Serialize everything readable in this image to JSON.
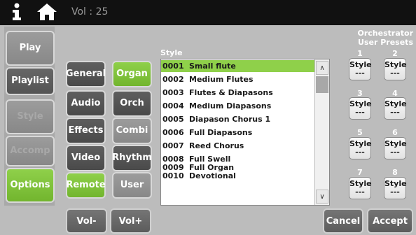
{
  "topbar": {
    "volume": "Vol : 25"
  },
  "left_nav": {
    "play": "Play",
    "playlist": "Playlist",
    "style": "Style",
    "accomp": "Accomp",
    "options": "Options"
  },
  "settings": {
    "general": "General",
    "audio": "Audio",
    "effects": "Effects",
    "video": "Video",
    "remote": "Remote"
  },
  "categories": {
    "organ": "Organ",
    "orch": "Orch",
    "combi": "Combi",
    "rhythm": "Rhythm",
    "user": "User"
  },
  "style_list": {
    "header": "Style",
    "items": [
      {
        "num": "0001",
        "name": "Small flute"
      },
      {
        "num": "0002",
        "name": "Medium Flutes"
      },
      {
        "num": "0003",
        "name": "Flutes & Diapasons"
      },
      {
        "num": "0004",
        "name": "Medium Diapasons"
      },
      {
        "num": "0005",
        "name": "Diapason Chorus 1"
      },
      {
        "num": "0006",
        "name": "Full Diapasons"
      },
      {
        "num": "0007",
        "name": "Reed Chorus"
      },
      {
        "num": "0008",
        "name": "Full Swell"
      },
      {
        "num": "0009",
        "name": "Full Organ"
      },
      {
        "num": "0010",
        "name": "Devotional"
      }
    ],
    "scroll_up": "∧",
    "scroll_down": "∨"
  },
  "presets": {
    "title_line1": "Orchestrator",
    "title_line2": "User Presets",
    "items": [
      {
        "num": "1",
        "label": "Style",
        "value": "---"
      },
      {
        "num": "2",
        "label": "Style",
        "value": "---"
      },
      {
        "num": "3",
        "label": "Style",
        "value": "---"
      },
      {
        "num": "4",
        "label": "Style",
        "value": "---"
      },
      {
        "num": "5",
        "label": "Style",
        "value": "---"
      },
      {
        "num": "6",
        "label": "Style",
        "value": "---"
      },
      {
        "num": "7",
        "label": "Style",
        "value": "---"
      },
      {
        "num": "8",
        "label": "Style",
        "value": "---"
      }
    ]
  },
  "bottom": {
    "vol_minus": "Vol-",
    "vol_plus": "Vol+",
    "cancel": "Cancel",
    "accept": "Accept"
  },
  "colors": {
    "accent_green": "#8fd04a",
    "topbar": "#111111",
    "background": "#bcbcbc"
  }
}
